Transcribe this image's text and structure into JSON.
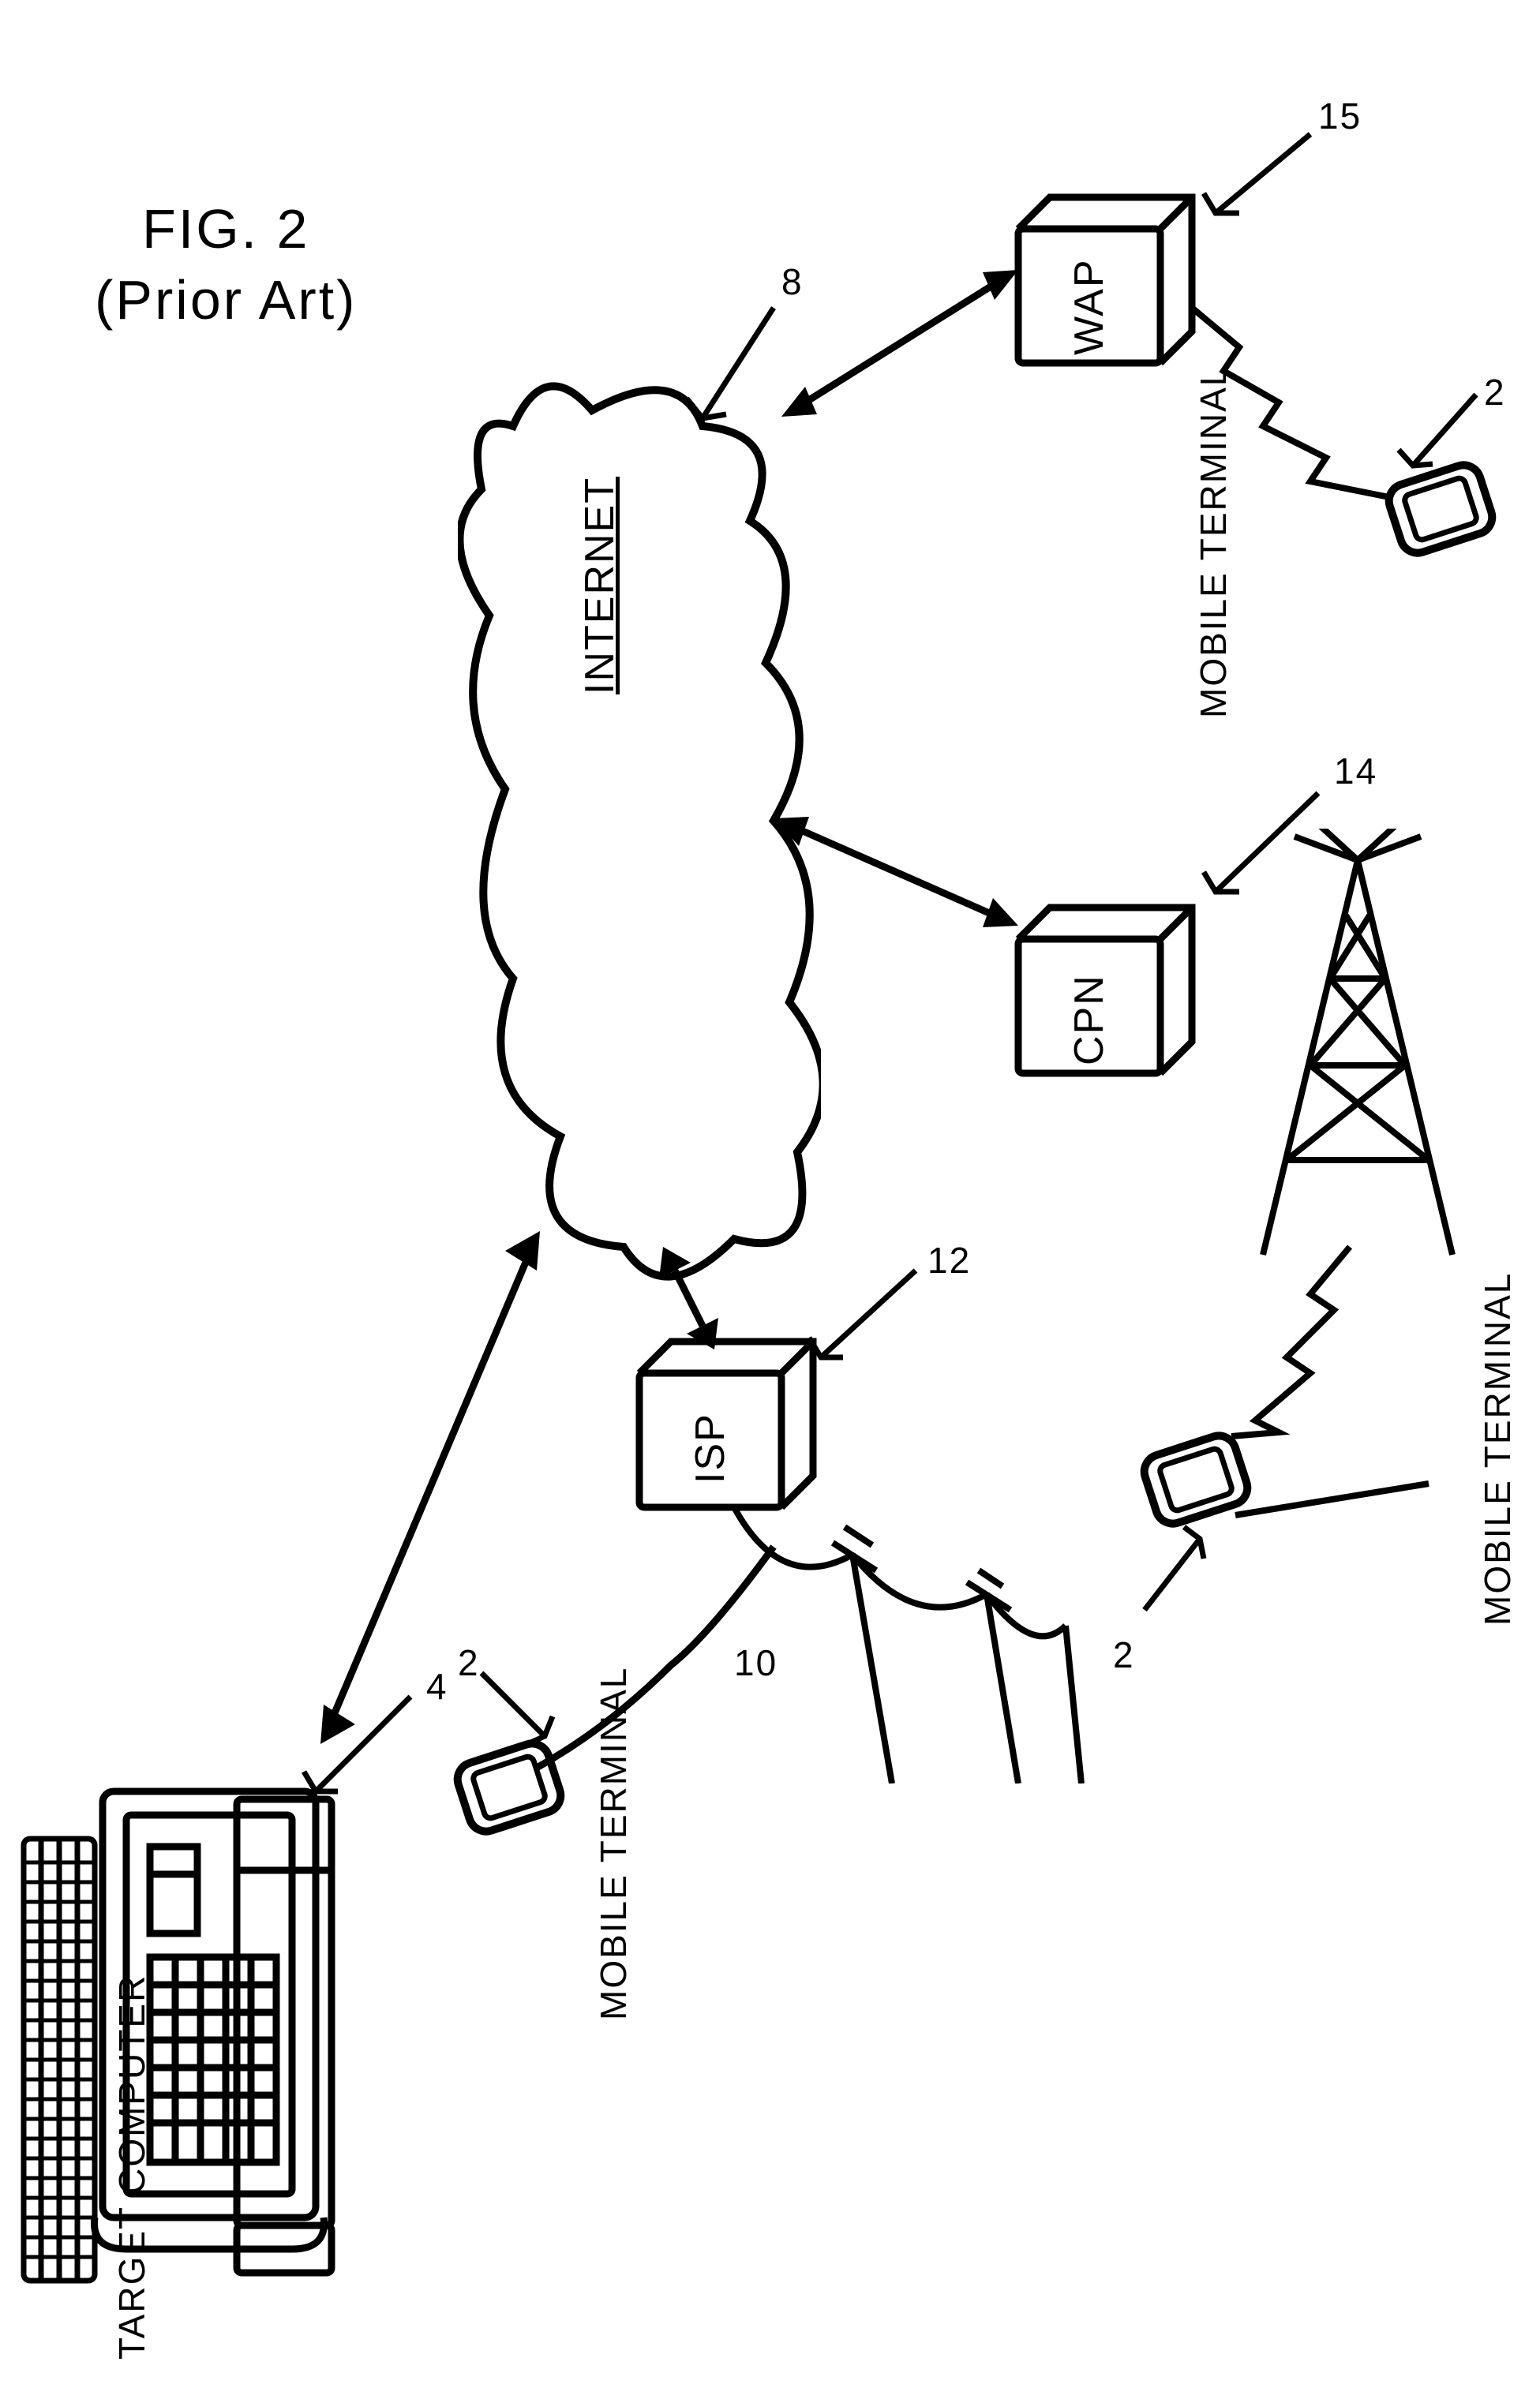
{
  "figure": {
    "title": "FIG. 2",
    "subtitle": "(Prior Art)"
  },
  "nodes": {
    "internet": {
      "label": "INTERNET",
      "callout": "8"
    },
    "target_computer": {
      "label": "TARGET COMPUTER",
      "callout": "4"
    },
    "isp": {
      "label": "ISP",
      "callout": "12",
      "cable_callout": "10"
    },
    "cpn": {
      "label": "CPN",
      "callout": "14"
    },
    "wap": {
      "label": "WAP",
      "callout": "15"
    },
    "mobile_terminal_isp": {
      "label": "MOBILE TERMINAL",
      "callout": "2"
    },
    "mobile_terminal_cpn": {
      "label": "MOBILE TERMINAL",
      "callout": "2"
    },
    "mobile_terminal_wap": {
      "label": "MOBILE TERMINAL",
      "callout": "2"
    }
  }
}
